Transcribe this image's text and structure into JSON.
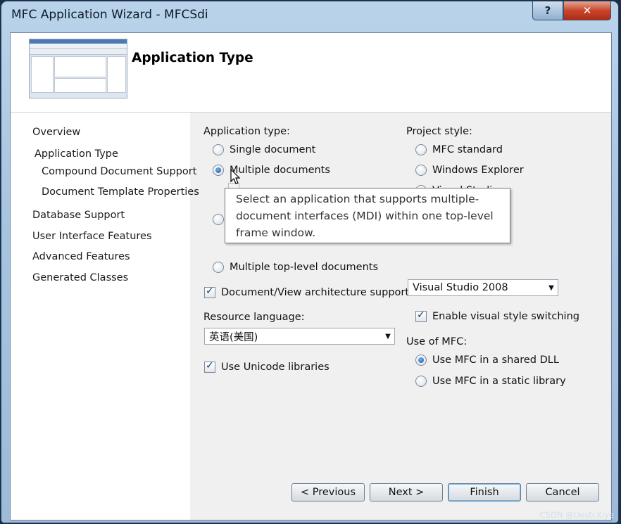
{
  "window": {
    "title": "MFC Application Wizard - MFCSdi",
    "help_glyph": "?",
    "close_glyph": "✕"
  },
  "banner": {
    "title": "Application Type"
  },
  "nav": {
    "items": [
      "Overview",
      "Application Type",
      "Compound Document Support",
      "Document Template Properties",
      "Database Support",
      "User Interface Features",
      "Advanced Features",
      "Generated Classes"
    ]
  },
  "app_type": {
    "label": "Application type:",
    "options": [
      "Single document",
      "Multiple documents",
      "Multiple top-level documents"
    ],
    "selected": "Multiple documents"
  },
  "project_style": {
    "label": "Project style:",
    "options": [
      "MFC standard",
      "Windows Explorer",
      "Visual Studio"
    ],
    "visual_style_value": "Visual Studio 2008",
    "enable_switching": "Enable visual style switching"
  },
  "docview": {
    "label": "Document/View architecture support",
    "checked": true
  },
  "resource_language": {
    "label": "Resource language:",
    "value": "英语(美国)"
  },
  "unicode": {
    "label": "Use Unicode libraries",
    "checked": true
  },
  "use_mfc": {
    "label": "Use of MFC:",
    "options": [
      "Use MFC in a shared DLL",
      "Use MFC in a static library"
    ],
    "selected": "Use MFC in a shared DLL"
  },
  "tooltip": {
    "text": "Select an application that supports multiple-document interfaces (MDI) within one top-level frame window."
  },
  "buttons": {
    "previous": "< Previous",
    "next": "Next >",
    "finish": "Finish",
    "cancel": "Cancel"
  },
  "watermark": "CSDN @UestcXiye"
}
